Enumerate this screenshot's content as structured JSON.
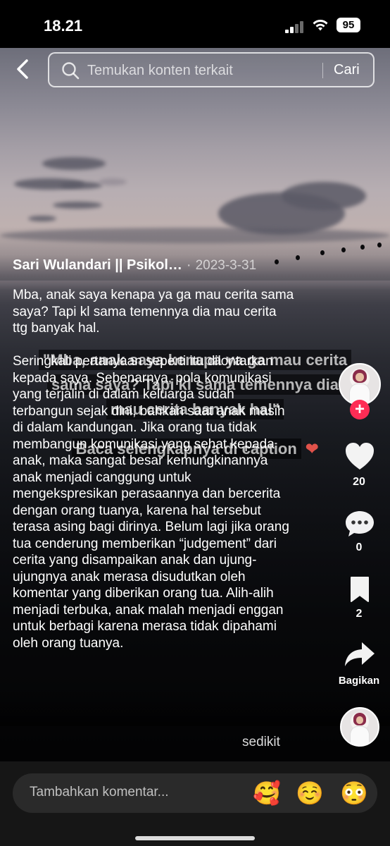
{
  "status_bar": {
    "time": "18.21",
    "battery": "95"
  },
  "search": {
    "placeholder": "Temukan konten terkait",
    "submit_label": "Cari"
  },
  "video": {
    "burned_text_lines": [
      "\"Mba, anak saya kenapa ya ga mau cerita",
      "sama saya? Tapi kl sama temennya dia",
      "mau cerita banyak hal\"",
      "Baca selengkapnya di caption"
    ]
  },
  "post": {
    "author": "Sari Wulandari || Psikol…",
    "separator": "·",
    "date": "2023-3-31",
    "question": "Mba, anak saya kenapa ya ga mau cerita sama saya? Tapi kl sama temennya dia mau cerita ttg banyak hal.",
    "body": "Seringkali pertanyaan seperti itu dilontarkan kepada saya. Sebenarnya, pola komunikasi yang terjalin di dalam keluarga sudah terbangun sejak dini, bahkan saat anak masih di dalam kandungan. Jika orang tua tidak membangun komunikasi yang sehat kepada anak, maka sangat besar kemungkinannya anak menjadi canggung untuk mengekspresikan perasaannya dan bercerita dengan orang tuanya, karena hal tersebut terasa asing bagi dirinya. Belum lagi jika orang tua cenderung memberikan “judgement” dari cerita yang disampaikan anak dan ujung-ujungnya anak merasa disudutkan oleh komentar yang diberikan orang tua. Alih-alih menjadi terbuka, anak malah menjadi enggan untuk berbagi karena merasa tidak dipahami oleh orang tuanya.",
    "more_label": "sedikit"
  },
  "actions": {
    "like_count": "20",
    "comment_count": "0",
    "bookmark_count": "2",
    "share_label": "Bagikan",
    "follow_symbol": "+"
  },
  "comment_bar": {
    "placeholder": "Tambahkan komentar...",
    "emojis": [
      "🥰",
      "☺️",
      "😳"
    ]
  },
  "colors": {
    "accent_follow": "#fe2c55",
    "bottom_bar": "#161616"
  }
}
